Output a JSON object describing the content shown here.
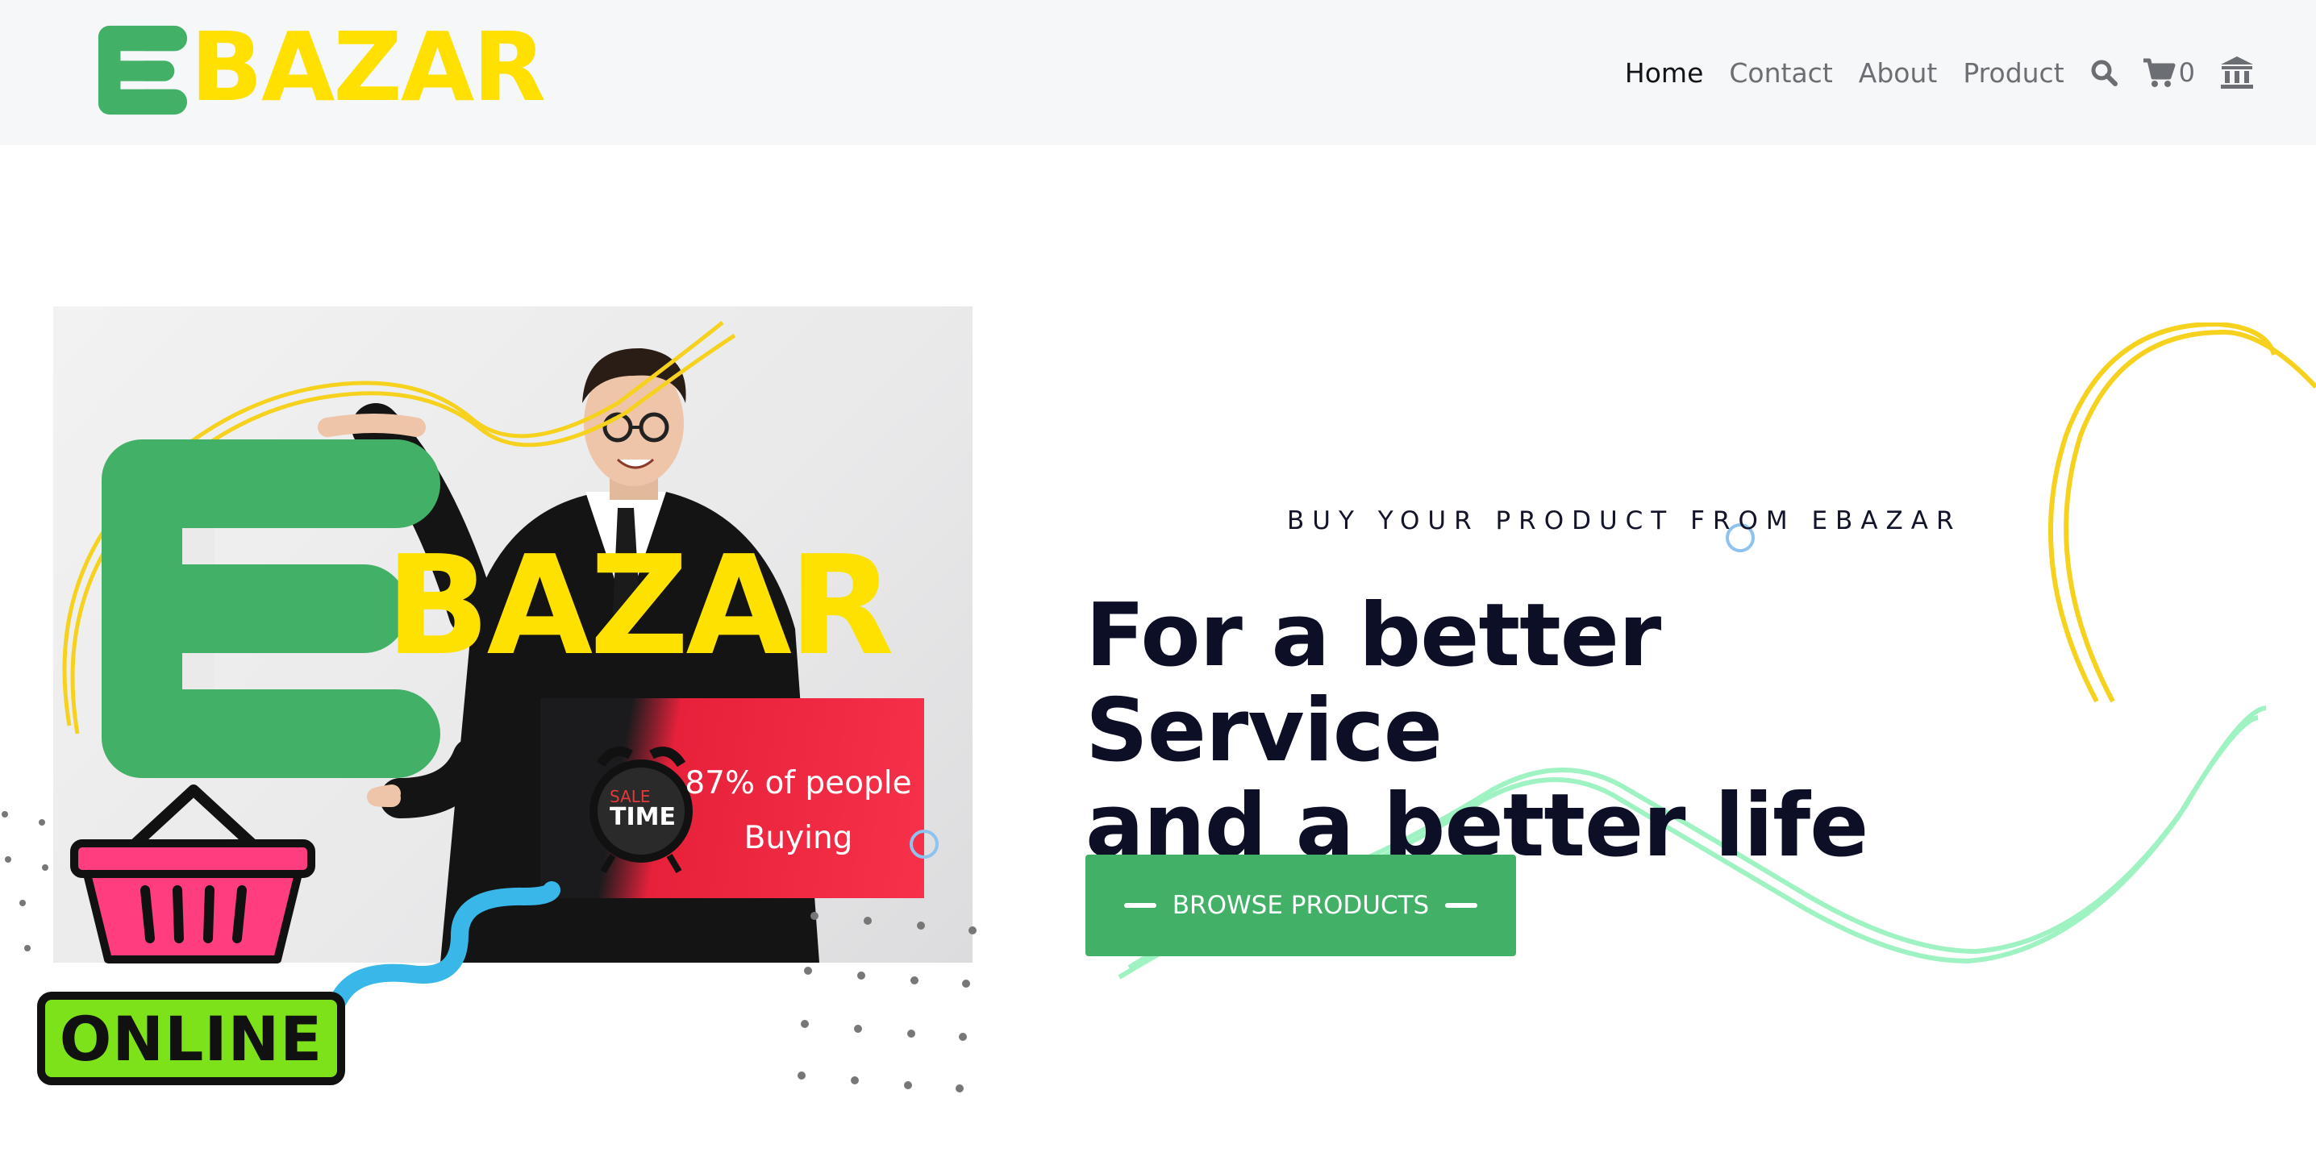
{
  "header": {
    "brand": "BAZAR",
    "nav": [
      {
        "label": "Home",
        "active": true
      },
      {
        "label": "Contact",
        "active": false
      },
      {
        "label": "About",
        "active": false
      },
      {
        "label": "Product",
        "active": false
      }
    ],
    "cart_count": "0",
    "icons": [
      "search-icon",
      "cart-icon",
      "bank-icon"
    ]
  },
  "hero_image": {
    "brand_text": "BAZAR",
    "sale_badge": {
      "line1": "SALE",
      "line2": "TIME"
    },
    "sale_caption_line1": "87% of people",
    "sale_caption_line2": "Buying",
    "online_badge": "ONLINE"
  },
  "hero": {
    "eyebrow": "BUY YOUR PRODUCT FROM EBAZAR",
    "headline_line1": "For a better Service",
    "headline_line2": "and a better life",
    "cta_label": "BROWSE PRODUCTS"
  },
  "colors": {
    "brand_green": "#42b066",
    "brand_yellow": "#ffe000",
    "headline": "#0c0f26",
    "header_bg": "#f6f7f9",
    "sale_red": "#f73149"
  }
}
